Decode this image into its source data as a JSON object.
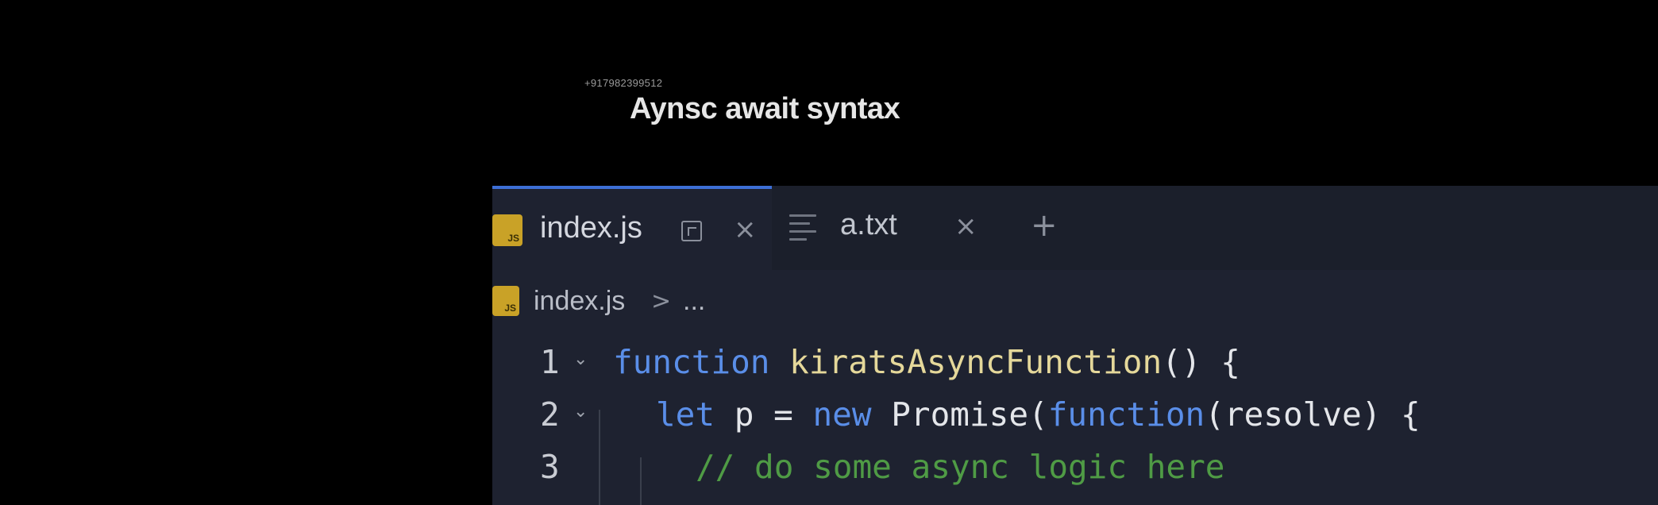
{
  "overlay": {
    "watermark": "+917982399512",
    "title": "Aynsc await syntax"
  },
  "editor": {
    "tabs": [
      {
        "label": "index.js",
        "icon": "js-file-icon",
        "badge": "JS",
        "active": true
      },
      {
        "label": "a.txt",
        "icon": "text-file-icon",
        "active": false
      }
    ],
    "breadcrumb": {
      "file": "index.js",
      "badge": "JS",
      "separator": ">",
      "rest": "..."
    },
    "colors": {
      "keyword": "#5a8ee8",
      "function": "#e5d89a",
      "identifier": "#e4e6ea",
      "comment": "#4f9b45",
      "active_tab_border": "#3d6fd6"
    },
    "lines": [
      {
        "number": "1",
        "tokens": {
          "t1": "function",
          "t2": " ",
          "t3": "kiratsAsyncFunction",
          "t4": "() {"
        }
      },
      {
        "number": "2",
        "tokens": {
          "t1": "let",
          "t2": " p = ",
          "t3": "new",
          "t4": " Promise(",
          "t5": "function",
          "t6": "(resolve) {"
        }
      },
      {
        "number": "3",
        "tokens": {
          "t1": "// do some async logic here"
        }
      }
    ]
  }
}
